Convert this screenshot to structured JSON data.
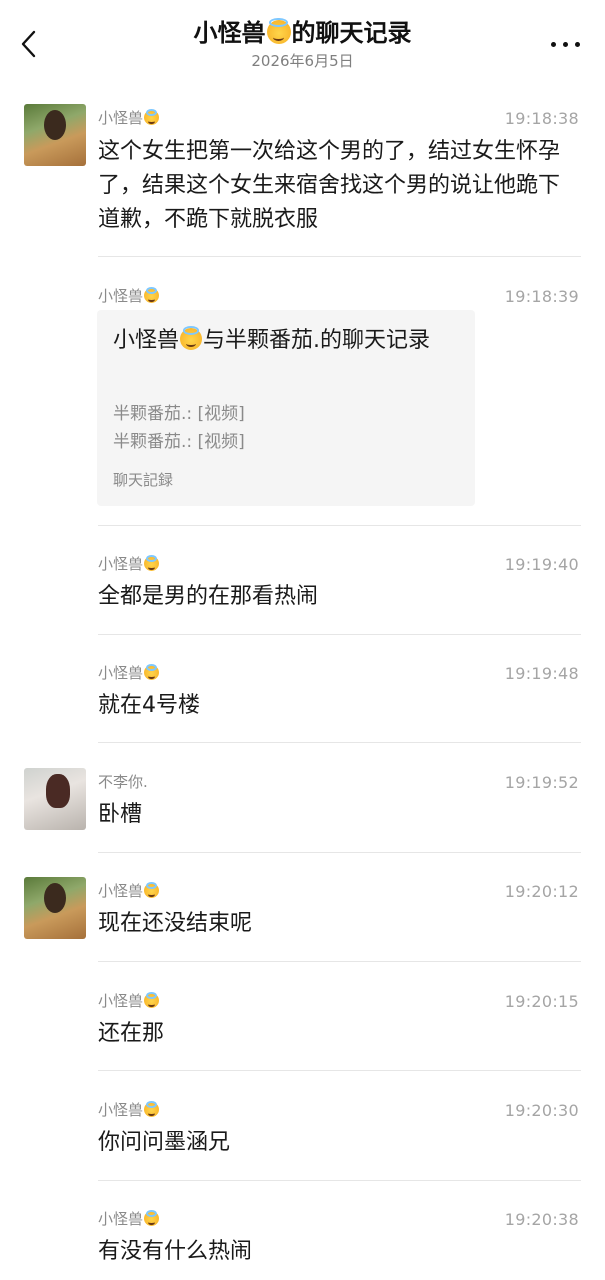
{
  "header": {
    "title_prefix": "小怪兽",
    "title_suffix": "的聊天记录",
    "date": "2026年6月5日"
  },
  "messages": [
    {
      "sender": "小怪兽",
      "time": "19:18:38",
      "text": "这个女生把第一次给这个男的了，结过女生怀孕了，结果这个女生来宿舍找这个男的说让他跪下道歉，不跪下就脱衣服"
    },
    {
      "sender": "小怪兽",
      "time": "19:18:39",
      "card": {
        "title_a": "小怪兽",
        "title_b": "与半颗番茄.的聊天记录",
        "line1": "半颗番茄.: [视频]",
        "line2": "半颗番茄.: [视频]",
        "footer": "聊天記録"
      }
    },
    {
      "sender": "小怪兽",
      "time": "19:19:40",
      "text": "全都是男的在那看热闹"
    },
    {
      "sender": "小怪兽",
      "time": "19:19:48",
      "text": "就在4号楼"
    },
    {
      "sender": "不李你.",
      "time": "19:19:52",
      "text": "卧槽"
    },
    {
      "sender": "小怪兽",
      "time": "19:20:12",
      "text": "现在还没结束呢"
    },
    {
      "sender": "小怪兽",
      "time": "19:20:15",
      "text": "还在那"
    },
    {
      "sender": "小怪兽",
      "time": "19:20:30",
      "text": "你问问墨涵兄"
    },
    {
      "sender": "小怪兽",
      "time": "19:20:38",
      "text": "有没有什么热闹"
    }
  ]
}
